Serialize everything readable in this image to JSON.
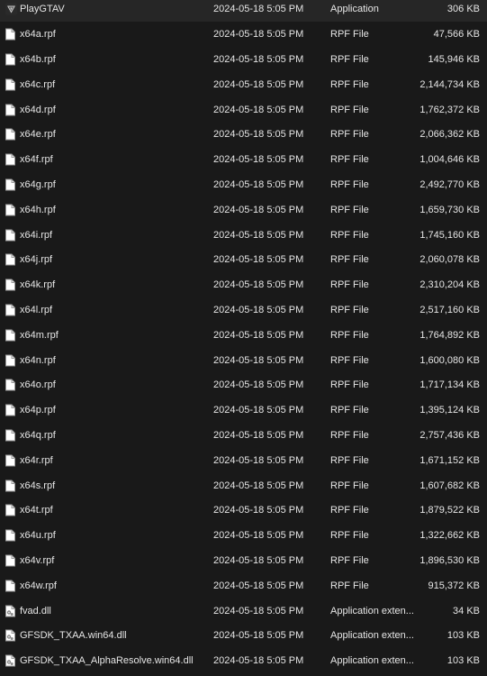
{
  "files": [
    {
      "name": "PlayGTAV",
      "date": "2024-05-18 5:05 PM",
      "type": "Application",
      "size": "306 KB",
      "icon": "gtav-app-icon"
    },
    {
      "name": "x64a.rpf",
      "date": "2024-05-18 5:05 PM",
      "type": "RPF File",
      "size": "47,566 KB",
      "icon": "file-icon"
    },
    {
      "name": "x64b.rpf",
      "date": "2024-05-18 5:05 PM",
      "type": "RPF File",
      "size": "145,946 KB",
      "icon": "file-icon"
    },
    {
      "name": "x64c.rpf",
      "date": "2024-05-18 5:05 PM",
      "type": "RPF File",
      "size": "2,144,734 KB",
      "icon": "file-icon"
    },
    {
      "name": "x64d.rpf",
      "date": "2024-05-18 5:05 PM",
      "type": "RPF File",
      "size": "1,762,372 KB",
      "icon": "file-icon"
    },
    {
      "name": "x64e.rpf",
      "date": "2024-05-18 5:05 PM",
      "type": "RPF File",
      "size": "2,066,362 KB",
      "icon": "file-icon"
    },
    {
      "name": "x64f.rpf",
      "date": "2024-05-18 5:05 PM",
      "type": "RPF File",
      "size": "1,004,646 KB",
      "icon": "file-icon"
    },
    {
      "name": "x64g.rpf",
      "date": "2024-05-18 5:05 PM",
      "type": "RPF File",
      "size": "2,492,770 KB",
      "icon": "file-icon"
    },
    {
      "name": "x64h.rpf",
      "date": "2024-05-18 5:05 PM",
      "type": "RPF File",
      "size": "1,659,730 KB",
      "icon": "file-icon"
    },
    {
      "name": "x64i.rpf",
      "date": "2024-05-18 5:05 PM",
      "type": "RPF File",
      "size": "1,745,160 KB",
      "icon": "file-icon"
    },
    {
      "name": "x64j.rpf",
      "date": "2024-05-18 5:05 PM",
      "type": "RPF File",
      "size": "2,060,078 KB",
      "icon": "file-icon"
    },
    {
      "name": "x64k.rpf",
      "date": "2024-05-18 5:05 PM",
      "type": "RPF File",
      "size": "2,310,204 KB",
      "icon": "file-icon"
    },
    {
      "name": "x64l.rpf",
      "date": "2024-05-18 5:05 PM",
      "type": "RPF File",
      "size": "2,517,160 KB",
      "icon": "file-icon"
    },
    {
      "name": "x64m.rpf",
      "date": "2024-05-18 5:05 PM",
      "type": "RPF File",
      "size": "1,764,892 KB",
      "icon": "file-icon"
    },
    {
      "name": "x64n.rpf",
      "date": "2024-05-18 5:05 PM",
      "type": "RPF File",
      "size": "1,600,080 KB",
      "icon": "file-icon"
    },
    {
      "name": "x64o.rpf",
      "date": "2024-05-18 5:05 PM",
      "type": "RPF File",
      "size": "1,717,134 KB",
      "icon": "file-icon"
    },
    {
      "name": "x64p.rpf",
      "date": "2024-05-18 5:05 PM",
      "type": "RPF File",
      "size": "1,395,124 KB",
      "icon": "file-icon"
    },
    {
      "name": "x64q.rpf",
      "date": "2024-05-18 5:05 PM",
      "type": "RPF File",
      "size": "2,757,436 KB",
      "icon": "file-icon"
    },
    {
      "name": "x64r.rpf",
      "date": "2024-05-18 5:05 PM",
      "type": "RPF File",
      "size": "1,671,152 KB",
      "icon": "file-icon"
    },
    {
      "name": "x64s.rpf",
      "date": "2024-05-18 5:05 PM",
      "type": "RPF File",
      "size": "1,607,682 KB",
      "icon": "file-icon"
    },
    {
      "name": "x64t.rpf",
      "date": "2024-05-18 5:05 PM",
      "type": "RPF File",
      "size": "1,879,522 KB",
      "icon": "file-icon"
    },
    {
      "name": "x64u.rpf",
      "date": "2024-05-18 5:05 PM",
      "type": "RPF File",
      "size": "1,322,662 KB",
      "icon": "file-icon"
    },
    {
      "name": "x64v.rpf",
      "date": "2024-05-18 5:05 PM",
      "type": "RPF File",
      "size": "1,896,530 KB",
      "icon": "file-icon"
    },
    {
      "name": "x64w.rpf",
      "date": "2024-05-18 5:05 PM",
      "type": "RPF File",
      "size": "915,372 KB",
      "icon": "file-icon"
    },
    {
      "name": "fvad.dll",
      "date": "2024-05-18 5:05 PM",
      "type": "Application exten...",
      "size": "34 KB",
      "icon": "dll-file-icon"
    },
    {
      "name": "GFSDK_TXAA.win64.dll",
      "date": "2024-05-18 5:05 PM",
      "type": "Application exten...",
      "size": "103 KB",
      "icon": "dll-file-icon"
    },
    {
      "name": "GFSDK_TXAA_AlphaResolve.win64.dll",
      "date": "2024-05-18 5:05 PM",
      "type": "Application exten...",
      "size": "103 KB",
      "icon": "dll-file-icon"
    }
  ]
}
